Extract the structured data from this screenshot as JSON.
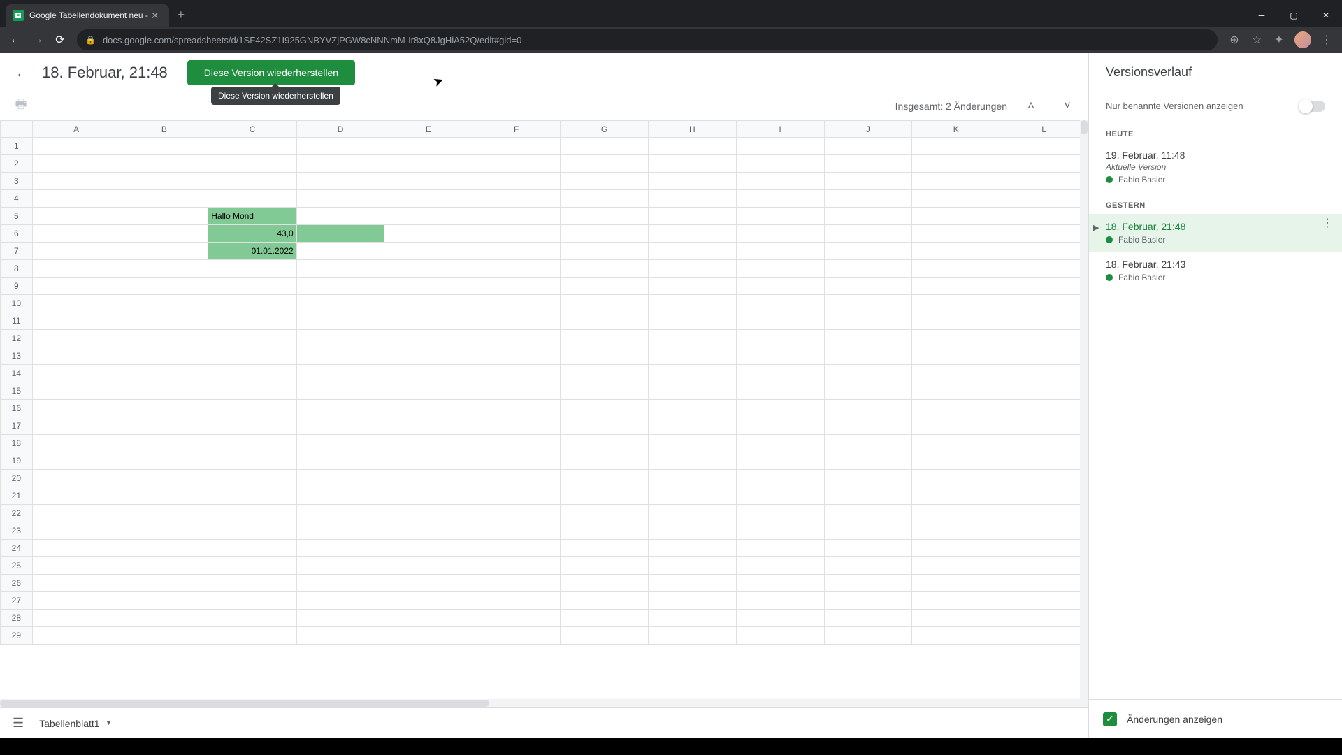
{
  "browser": {
    "tab_title": "Google Tabellendokument neu -",
    "url": "docs.google.com/spreadsheets/d/1SF42SZ1I925GNBYVZjPGW8cNNNmM-Ir8xQ8JgHiA52Q/edit#gid=0"
  },
  "header": {
    "version_title": "18. Februar, 21:48",
    "restore_button": "Diese Version wiederherstellen",
    "tooltip": "Diese Version wiederherstellen"
  },
  "subheader": {
    "changes_text": "Insgesamt: 2 Änderungen"
  },
  "sheet": {
    "columns": [
      "A",
      "B",
      "C",
      "D",
      "E",
      "F",
      "G",
      "H",
      "I",
      "J",
      "K",
      "L"
    ],
    "rows": 29,
    "cells": {
      "c5": "Hallo Mond",
      "c6": "43,0",
      "c7": "01.01.2022"
    },
    "tab_name": "Tabellenblatt1"
  },
  "sidebar": {
    "title": "Versionsverlauf",
    "named_only_label": "Nur benannte Versionen anzeigen",
    "sections": {
      "today": "HEUTE",
      "yesterday": "GESTERN"
    },
    "versions": {
      "v1": {
        "time": "19. Februar, 11:48",
        "sub": "Aktuelle Version",
        "author": "Fabio Basler"
      },
      "v2": {
        "time": "18. Februar, 21:48",
        "author": "Fabio Basler"
      },
      "v3": {
        "time": "18. Februar, 21:43",
        "author": "Fabio Basler"
      }
    },
    "footer_label": "Änderungen anzeigen"
  }
}
